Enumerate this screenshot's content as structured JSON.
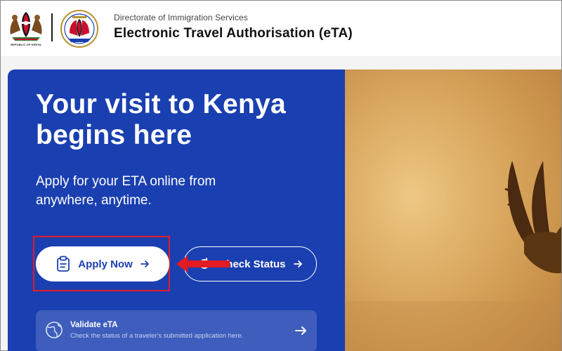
{
  "header": {
    "coat_of_arms_caption": "REPUBLIC OF KENYA",
    "department": "Directorate of Immigration Services",
    "title": "Electronic Travel Authorisation (eTA)"
  },
  "hero": {
    "title": "Your visit to Kenya begins here",
    "subtitle": "Apply for your ETA online from anywhere, anytime.",
    "apply_button": {
      "label": "Apply Now",
      "icon": "clipboard-icon",
      "arrow_icon": "arrow-right-icon"
    },
    "check_button": {
      "label": "Check Status",
      "icon": "refresh-icon",
      "arrow_icon": "arrow-right-icon"
    },
    "validate_card": {
      "title": "Validate eTA",
      "description": "Check the status of a traveler's submitted application here.",
      "icon": "globe-icon",
      "arrow_icon": "arrow-right-icon"
    }
  },
  "colors": {
    "hero_blue": "#1a3fb0",
    "highlight_red": "#e31b23",
    "savanna_gold": "#ddaa60"
  }
}
